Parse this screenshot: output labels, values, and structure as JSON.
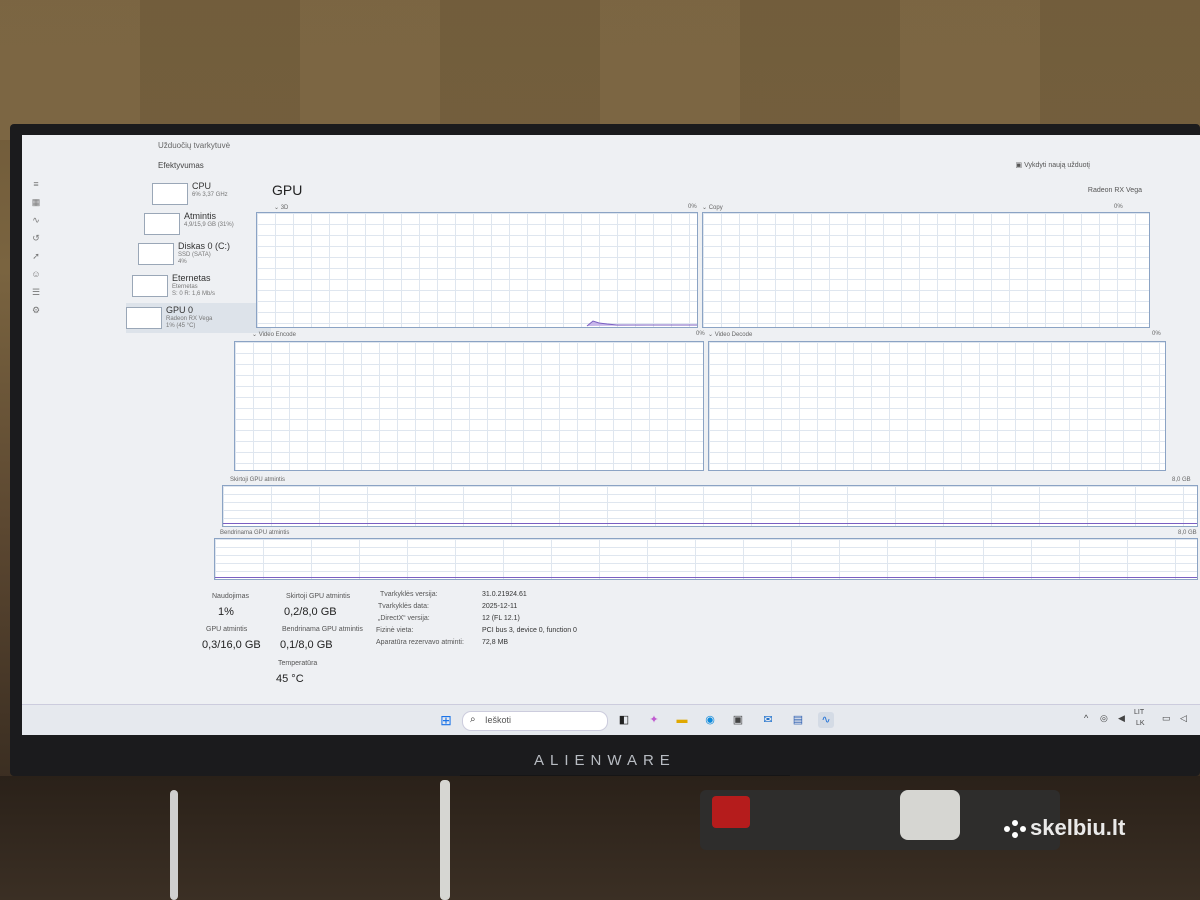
{
  "app": {
    "title": "Užduočių tvarkytuvė",
    "section": "Efektyvumas",
    "run_task": "Vykdyti naują užduotį"
  },
  "sidebar": {
    "items": [
      {
        "name": "CPU",
        "sub": "6% 3,37 GHz",
        "sub2": ""
      },
      {
        "name": "Atmintis",
        "sub": "4,9/15,9 GB (31%)",
        "sub2": ""
      },
      {
        "name": "Diskas 0 (C:)",
        "sub": "SSD (SATA)",
        "sub2": "4%"
      },
      {
        "name": "Eternetas",
        "sub": "Eternetas",
        "sub2": "S: 0 R: 1,6 Mb/s"
      },
      {
        "name": "GPU 0",
        "sub": "Radeon RX Vega",
        "sub2": "1% (45 °C)"
      }
    ]
  },
  "main": {
    "title": "GPU",
    "adapter": "Radeon RX Vega",
    "graphs": {
      "g3d": {
        "label": "3D",
        "percent": "0%"
      },
      "copy": {
        "label": "Copy",
        "percent": "0%"
      },
      "encode": {
        "label": "Video Encode",
        "percent": "0%"
      },
      "decode": {
        "label": "Video Decode",
        "percent": "0%"
      },
      "dedicated": {
        "label": "Skirtoji GPU atmintis",
        "max": "8,0 GB"
      },
      "shared": {
        "label": "Bendrinama GPU atmintis",
        "max": "8,0 GB"
      }
    }
  },
  "stats": {
    "utilization": {
      "label": "Naudojimas",
      "value": "1%"
    },
    "dedicated_mem": {
      "label": "Skirtoji GPU atmintis",
      "value": "0,2/8,0 GB"
    },
    "gpu_mem": {
      "label": "GPU atmintis",
      "value": "0,3/16,0 GB"
    },
    "shared_mem": {
      "label": "Bendrinama GPU atmintis",
      "value": "0,1/8,0 GB"
    },
    "temperature": {
      "label": "Temperatūra",
      "value": "45 °C"
    }
  },
  "details": [
    {
      "label": "Tvarkyklės versija:",
      "value": "31.0.21924.61"
    },
    {
      "label": "Tvarkyklės data:",
      "value": "2025-12-11"
    },
    {
      "label": "„DirectX“ versija:",
      "value": "12 (FL 12.1)"
    },
    {
      "label": "Fizinė vieta:",
      "value": "PCI bus 3, device 0, function 0"
    },
    {
      "label": "Aparatūra rezervavo atminti:",
      "value": "72,8 MB"
    }
  ],
  "taskbar": {
    "search_placeholder": "Ieškoti",
    "lang_top": "LIT",
    "lang_bottom": "LK",
    "icons": [
      "start-icon",
      "task-view-icon",
      "copilot-icon",
      "file-explorer-icon",
      "edge-icon",
      "store-icon",
      "outlook-icon",
      "app-icon",
      "task-manager-icon"
    ]
  },
  "monitor_brand": "ALIENWARE",
  "watermark": "skelbiu.lt"
}
